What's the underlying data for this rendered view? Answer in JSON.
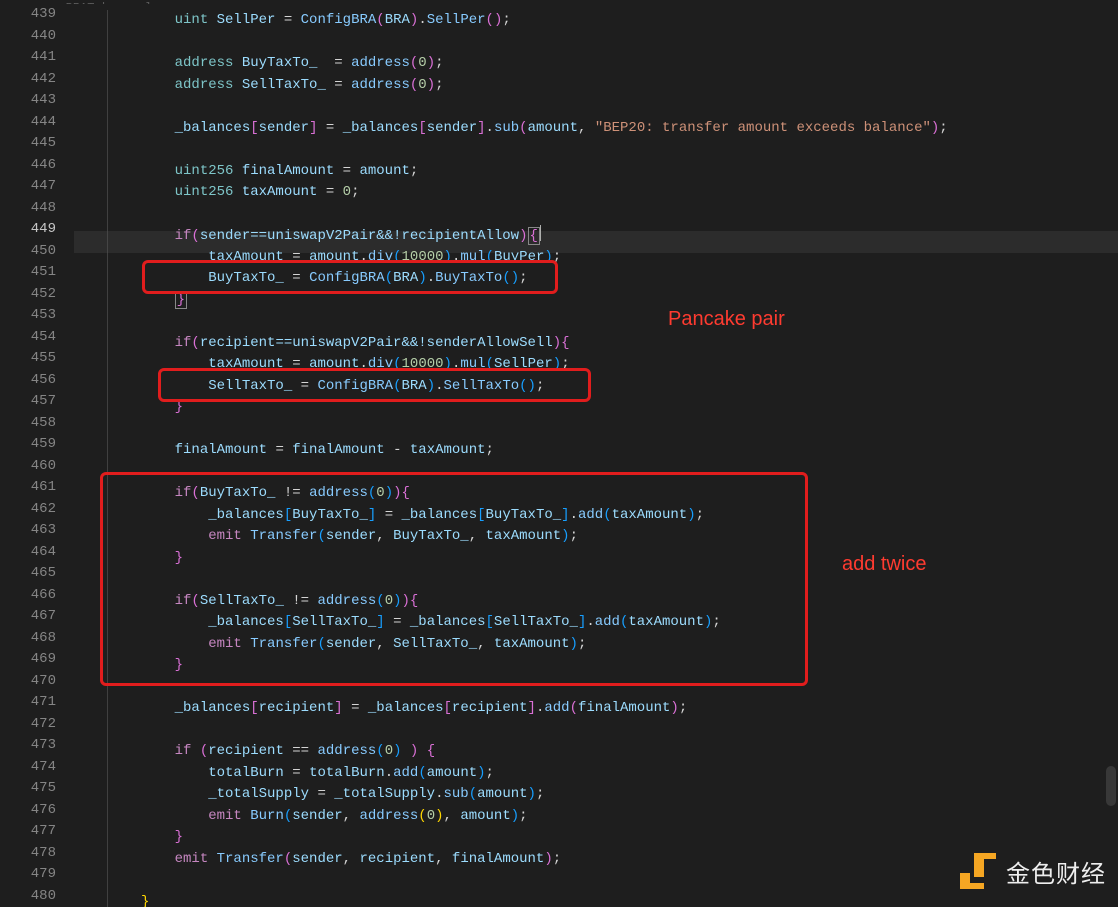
{
  "breadcrumb": "src › ◆ BRAToken.sol",
  "lines_start": 439,
  "lines_end": 480,
  "active_line": 449,
  "annotations": {
    "label1": "Pancake pair",
    "label2": "add twice"
  },
  "watermark": {
    "text": "金色财经"
  },
  "code": {
    "l439": {
      "indent": 12,
      "kw1": "uint",
      "id1": "SellPer",
      "op1": "=",
      "fn1": "ConfigBRA",
      "brmL": "(",
      "id2": "BRA",
      "brmR": ")",
      "dot": ".",
      "fn2": "SellPer",
      "brmL2": "(",
      "brmR2": ")",
      "semi": ";"
    },
    "l440": {
      "indent": 12
    },
    "l441": {
      "indent": 12,
      "kw1": "address",
      "id1": "BuyTaxTo_",
      "op1": "=",
      "fn1": "address",
      "brmL": "(",
      "num1": "0",
      "brmR": ")",
      "semi": ";"
    },
    "l442": {
      "indent": 12,
      "kw1": "address",
      "id1": "SellTaxTo_",
      "op1": "=",
      "fn1": "address",
      "brmL": "(",
      "num1": "0",
      "brmR": ")",
      "semi": ";"
    },
    "l443": {
      "indent": 12
    },
    "l444": {
      "indent": 12,
      "id1": "_balances",
      "brmL": "[",
      "id2": "sender",
      "brmR": "]",
      "op1": "=",
      "id3": "_balances",
      "brmL2": "[",
      "id4": "sender",
      "brmR2": "]",
      "dot": ".",
      "fn1": "sub",
      "brmL3": "(",
      "id5": "amount",
      "comma": ",",
      "str1": "\"BEP20: transfer amount exceeds balance\"",
      "brmR3": ")",
      "semi": ";"
    },
    "l445": {
      "indent": 12
    },
    "l446": {
      "indent": 12,
      "kw1": "uint256",
      "id1": "finalAmount",
      "op1": "=",
      "id2": "amount",
      "semi": ";"
    },
    "l447": {
      "indent": 12,
      "kw1": "uint256",
      "id1": "taxAmount",
      "op1": "=",
      "num1": "0",
      "semi": ";"
    },
    "l448": {
      "indent": 12
    },
    "l449": {
      "indent": 12,
      "kw1": "if",
      "brmL": "(",
      "body": "sender==uniswapV2Pair&&!recipientAllow",
      "brmR": ")",
      "brace": "{"
    },
    "l450": {
      "indent": 16,
      "id1": "taxAmount",
      "op1": "=",
      "id2": "amount",
      "dot": ".",
      "fn1": "div",
      "brbL": "(",
      "num1": "10000",
      "brbR": ")",
      "dot2": ".",
      "fn2": "mul",
      "brbL2": "(",
      "id3": "BuyPer",
      "brbR2": ")",
      "semi": ";"
    },
    "l451": {
      "indent": 16,
      "id1": "BuyTaxTo_",
      "op1": "=",
      "fn1": "ConfigBRA",
      "brbL": "(",
      "id2": "BRA",
      "brbR": ")",
      "dot": ".",
      "fn2": "BuyTaxTo",
      "brbL2": "(",
      "brbR2": ")",
      "semi": ";"
    },
    "l452": {
      "indent": 12,
      "brace": "}"
    },
    "l453": {
      "indent": 12
    },
    "l454": {
      "indent": 12,
      "kw1": "if",
      "brmL": "(",
      "body": "recipient==uniswapV2Pair&&!senderAllowSell",
      "brmR": ")",
      "brace": "{"
    },
    "l455": {
      "indent": 16,
      "id1": "taxAmount",
      "op1": "=",
      "id2": "amount",
      "dot": ".",
      "fn1": "div",
      "brbL": "(",
      "num1": "10000",
      "brbR": ")",
      "dot2": ".",
      "fn2": "mul",
      "brbL2": "(",
      "id3": "SellPer",
      "brbR2": ")",
      "semi": ";"
    },
    "l456": {
      "indent": 16,
      "id1": "SellTaxTo_",
      "op1": "=",
      "fn1": "ConfigBRA",
      "brbL": "(",
      "id2": "BRA",
      "brbR": ")",
      "dot": ".",
      "fn2": "SellTaxTo",
      "brbL2": "(",
      "brbR2": ")",
      "semi": ";"
    },
    "l457": {
      "indent": 12,
      "brace": "}"
    },
    "l458": {
      "indent": 12
    },
    "l459": {
      "indent": 12,
      "id1": "finalAmount",
      "op1": "=",
      "id2": "finalAmount",
      "op2": "-",
      "id3": "taxAmount",
      "semi": ";"
    },
    "l460": {
      "indent": 12
    },
    "l461": {
      "indent": 12,
      "kw1": "if",
      "brmL": "(",
      "id1": "BuyTaxTo_",
      "op1": "!=",
      "fn1": "address",
      "brbL": "(",
      "num1": "0",
      "brbR": ")",
      "brmR": ")",
      "brace": "{"
    },
    "l462": {
      "indent": 16,
      "id1": "_balances",
      "brbL": "[",
      "id2": "BuyTaxTo_",
      "brbR": "]",
      "op1": "=",
      "id3": "_balances",
      "brbL2": "[",
      "id4": "BuyTaxTo_",
      "brbR2": "]",
      "dot": ".",
      "fn1": "add",
      "brbL3": "(",
      "id5": "taxAmount",
      "brbR3": ")",
      "semi": ";"
    },
    "l463": {
      "indent": 16,
      "kw1": "emit",
      "fn1": "Transfer",
      "brbL": "(",
      "id1": "sender",
      "comma": ",",
      "id2": "BuyTaxTo_",
      "comma2": ",",
      "id3": "taxAmount",
      "brbR": ")",
      "semi": ";"
    },
    "l464": {
      "indent": 12,
      "brace": "}"
    },
    "l465": {
      "indent": 12
    },
    "l466": {
      "indent": 12,
      "kw1": "if",
      "brmL": "(",
      "id1": "SellTaxTo_",
      "op1": "!=",
      "fn1": "address",
      "brbL": "(",
      "num1": "0",
      "brbR": ")",
      "brmR": ")",
      "brace": "{"
    },
    "l467": {
      "indent": 16,
      "id1": "_balances",
      "brbL": "[",
      "id2": "SellTaxTo_",
      "brbR": "]",
      "op1": "=",
      "id3": "_balances",
      "brbL2": "[",
      "id4": "SellTaxTo_",
      "brbR2": "]",
      "dot": ".",
      "fn1": "add",
      "brbL3": "(",
      "id5": "taxAmount",
      "brbR3": ")",
      "semi": ";"
    },
    "l468": {
      "indent": 16,
      "kw1": "emit",
      "fn1": "Transfer",
      "brbL": "(",
      "id1": "sender",
      "comma": ",",
      "id2": "SellTaxTo_",
      "comma2": ",",
      "id3": "taxAmount",
      "brbR": ")",
      "semi": ";"
    },
    "l469": {
      "indent": 12,
      "brace": "}"
    },
    "l470": {
      "indent": 12
    },
    "l471": {
      "indent": 12,
      "id1": "_balances",
      "brmL": "[",
      "id2": "recipient",
      "brmR": "]",
      "op1": "=",
      "id3": "_balances",
      "brmL2": "[",
      "id4": "recipient",
      "brmR2": "]",
      "dot": ".",
      "fn1": "add",
      "brmL3": "(",
      "id5": "finalAmount",
      "brmR3": ")",
      "semi": ";"
    },
    "l472": {
      "indent": 12
    },
    "l473": {
      "indent": 12,
      "kw1": "if",
      "brmL": "(",
      "id1": "recipient",
      "op1": "==",
      "fn1": "address",
      "brbL": "(",
      "num1": "0",
      "brbR": ")",
      "brmR": ")",
      "brace": "{"
    },
    "l474": {
      "indent": 16,
      "id1": "totalBurn",
      "op1": "=",
      "id2": "totalBurn",
      "dot": ".",
      "fn1": "add",
      "brbL": "(",
      "id3": "amount",
      "brbR": ")",
      "semi": ";"
    },
    "l475": {
      "indent": 16,
      "id1": "_totalSupply",
      "op1": "=",
      "id2": "_totalSupply",
      "dot": ".",
      "fn1": "sub",
      "brbL": "(",
      "id3": "amount",
      "brbR": ")",
      "semi": ";"
    },
    "l476": {
      "indent": 16,
      "kw1": "emit",
      "fn1": "Burn",
      "brbL": "(",
      "id1": "sender",
      "comma": ",",
      "fn2": "address",
      "bryL": "(",
      "num1": "0",
      "bryR": ")",
      "comma2": ",",
      "id2": "amount",
      "brbR": ")",
      "semi": ";"
    },
    "l477": {
      "indent": 12,
      "brace": "}"
    },
    "l478": {
      "indent": 12,
      "kw1": "emit",
      "fn1": "Transfer",
      "brmL": "(",
      "id1": "sender",
      "comma": ",",
      "id2": "recipient",
      "comma2": ",",
      "id3": "finalAmount",
      "brmR": ")",
      "semi": ";"
    },
    "l479": {
      "indent": 12
    },
    "l480": {
      "indent": 8,
      "brace": "}"
    }
  }
}
